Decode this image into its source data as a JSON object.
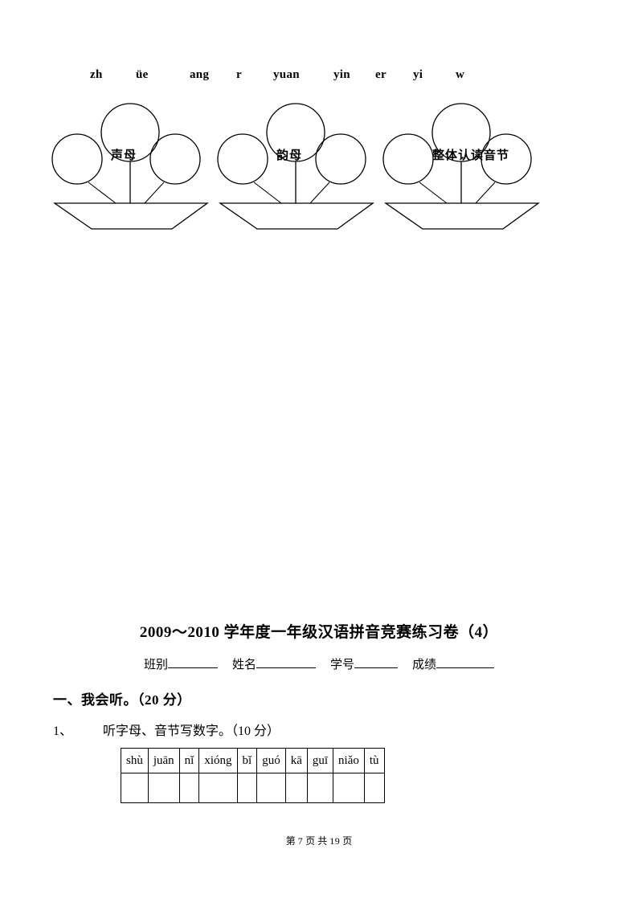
{
  "worksheet": {
    "letter_row": {
      "name": "pinyin-letter-list",
      "items": [
        "zh",
        "üe",
        "ang",
        "r",
        "yuan",
        "yin",
        "er",
        "yi",
        "w"
      ],
      "offsets": [
        0,
        57,
        124,
        182,
        228,
        303,
        355,
        402,
        455
      ]
    },
    "diagram": {
      "caption_note": "three balloon-basket sorting diagrams",
      "groups": [
        {
          "label": "声母",
          "balloons": 3
        },
        {
          "label": "韵母",
          "balloons": 3
        },
        {
          "label": "整体认读音节",
          "balloons": 3
        }
      ]
    },
    "exam": {
      "title": "2009～2010 学年度一年级汉语拼音竞赛练习卷（4）",
      "info_fields": [
        {
          "label": "班别",
          "value": ""
        },
        {
          "label": "姓名",
          "value": ""
        },
        {
          "label": "学号",
          "value": ""
        },
        {
          "label": "成绩",
          "value": ""
        }
      ],
      "section_heading": "一、我会听。（20 分）",
      "question_1": {
        "number": "1、",
        "text": "听字母、音节写数字。（10 分）"
      },
      "table": {
        "syllables": [
          "shù",
          "juān",
          "nǐ",
          "xióng",
          "bǐ",
          "guó",
          "kā",
          "guī",
          "niǎo",
          "tù"
        ],
        "answers": [
          "",
          "",
          "",
          "",
          "",
          "",
          "",
          "",
          "",
          ""
        ]
      }
    },
    "footer": {
      "prefix": "第",
      "page": "7",
      "middle": "页 共",
      "total": "19",
      "suffix": "页"
    },
    "colors": {
      "ink": "#000000",
      "paper": "#ffffff"
    }
  }
}
